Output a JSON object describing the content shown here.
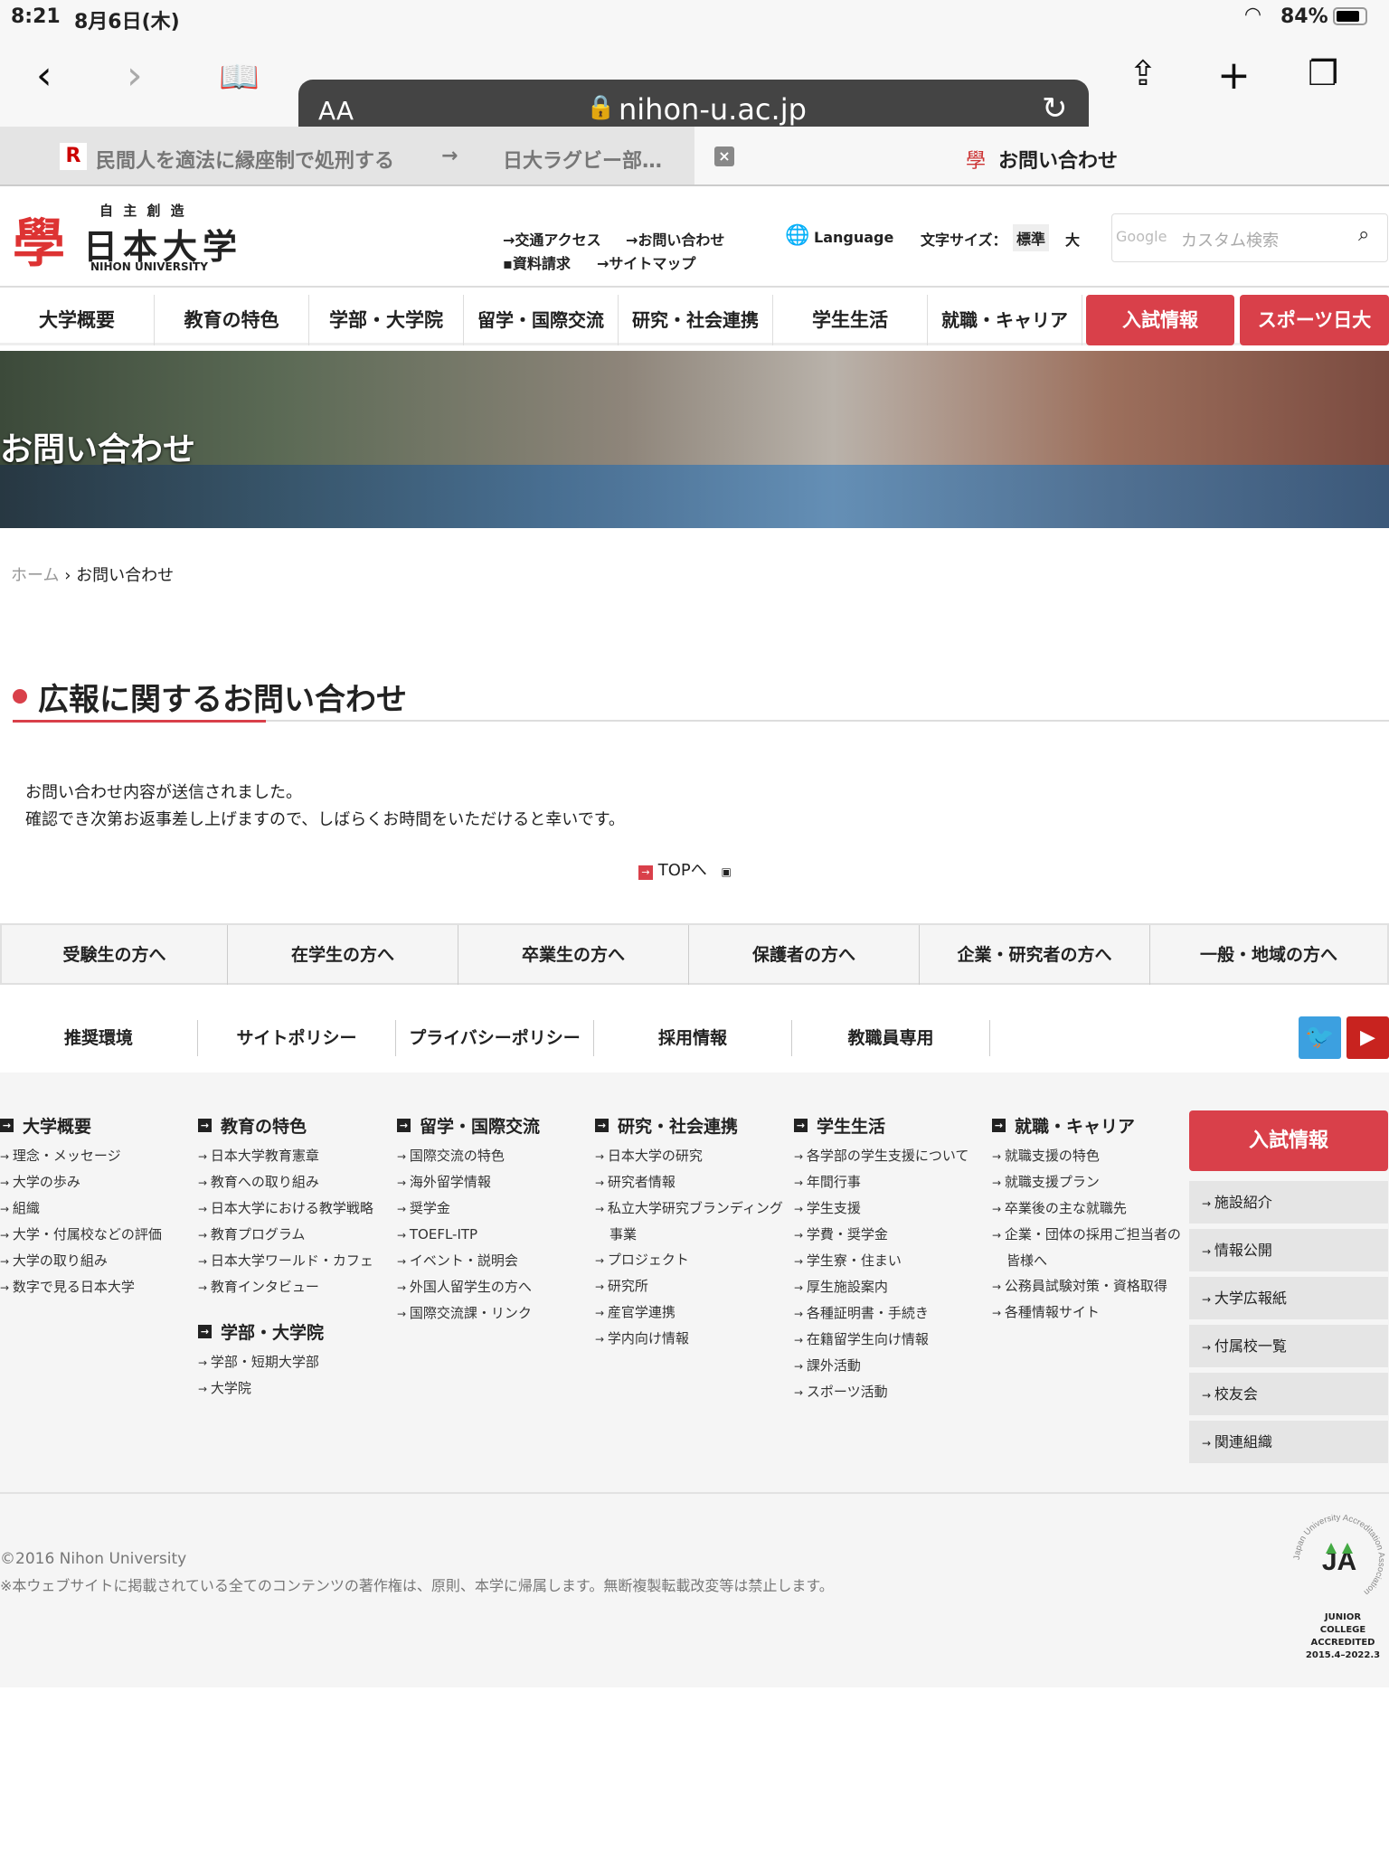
{
  "status": {
    "time": "8:21",
    "date": "8月6日(木)",
    "battery": "84%"
  },
  "browser": {
    "text_size": "AA",
    "url": "nihon-u.ac.jp",
    "tabs": [
      {
        "title": "民間人を適法に縁座制で処刑する",
        "arrow": "→",
        "subtitle": "日大ラグビー部…"
      },
      {
        "title": "お問い合わせ"
      }
    ]
  },
  "header": {
    "logo_motto": "自 主 創 造",
    "logo_name": "日本大学",
    "logo_en": "NIHON UNIVERSITY",
    "links": [
      "交通アクセス",
      "お問い合わせ",
      "資料請求",
      "サイトマップ"
    ],
    "language": "Language",
    "font_size_label": "文字サイズ：",
    "font_standard": "標準",
    "font_large": "大",
    "search_brand": "Google",
    "search_placeholder": "カスタム検索"
  },
  "nav": [
    "大学概要",
    "教育の特色",
    "学部・大学院",
    "留学・国際交流",
    "研究・社会連携",
    "学生生活",
    "就職・キャリア",
    "入試情報",
    "スポーツ日大"
  ],
  "hero_title": "お問い合わせ",
  "breadcrumb": {
    "home": "ホーム",
    "sep": "›",
    "current": "お問い合わせ"
  },
  "main": {
    "heading": "広報に関するお問い合わせ",
    "line1": "お問い合わせ内容が送信されました。",
    "line2": "確認でき次第お返事差し上げますので、しばらくお時間をいただけると幸いです。",
    "top_link": "TOPへ"
  },
  "audience": [
    "受験生の方へ",
    "在学生の方へ",
    "卒業生の方へ",
    "保護者の方へ",
    "企業・研究者の方へ",
    "一般・地域の方へ"
  ],
  "footer_links": [
    "推奨環境",
    "サイトポリシー",
    "プライバシーポリシー",
    "採用情報",
    "教職員専用"
  ],
  "footer_cols": [
    {
      "title": "大学概要",
      "items": [
        "理念・メッセージ",
        "大学の歩み",
        "組織",
        "大学・付属校などの評価",
        "大学の取り組み",
        "数字で見る日本大学"
      ]
    },
    {
      "title": "教育の特色",
      "items": [
        "日本大学教育憲章",
        "教育への取り組み",
        "日本大学における教学戦略",
        "教育プログラム",
        "日本大学ワールド・カフェ",
        "教育インタビュー"
      ]
    },
    {
      "title": "留学・国際交流",
      "items": [
        "国際交流の特色",
        "海外留学情報",
        "奨学金",
        "TOEFL-ITP",
        "イベント・説明会",
        "外国人留学生の方へ",
        "国際交流課・リンク"
      ]
    },
    {
      "title": "研究・社会連携",
      "items": [
        "日本大学の研究",
        "研究者情報",
        "私立大学研究ブランディング事業",
        "プロジェクト",
        "研究所",
        "産官学連携",
        "学内向け情報"
      ]
    },
    {
      "title": "学生生活",
      "items": [
        "各学部の学生支援について",
        "年間行事",
        "学生支援",
        "学費・奨学金",
        "学生寮・住まい",
        "厚生施設案内",
        "各種証明書・手続き",
        "在籍留学生向け情報",
        "課外活動",
        "スポーツ活動"
      ]
    },
    {
      "title": "就職・キャリア",
      "items": [
        "就職支援の特色",
        "就職支援プラン",
        "卒業後の主な就職先",
        "企業・団体の採用ご担当者の皆様へ",
        "公務員試験対策・資格取得",
        "各種情報サイト"
      ]
    }
  ],
  "footer_col_extra": {
    "title": "学部・大学院",
    "items": [
      "学部・短期大学部",
      "大学院"
    ]
  },
  "side": {
    "admission": "入試情報",
    "items": [
      "施設紹介",
      "情報公開",
      "大学広報紙",
      "付属校一覧",
      "校友会",
      "関連組織"
    ]
  },
  "copyright": "©2016 Nihon University",
  "notice": "※本ウェブサイトに掲載されている全てのコンテンツの著作権は、原則、本学に帰属します。無断複製転載改変等は禁止します。",
  "badge": {
    "ring": "Japan University Accreditation Association",
    "l1": "JUNIOR COLLEGE",
    "l2": "ACCREDITED",
    "l3": "2015.4–2022.3"
  },
  "colors": {
    "accent": "#d9404a"
  }
}
